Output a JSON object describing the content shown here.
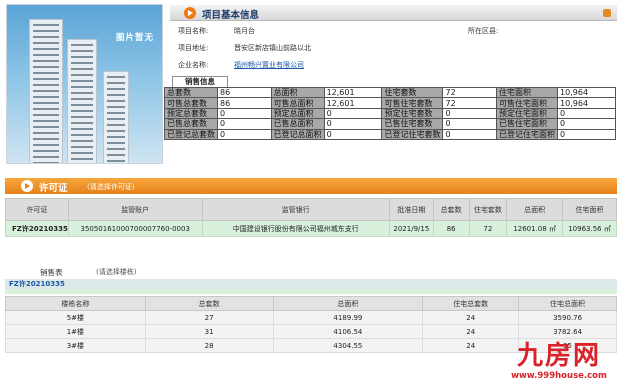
{
  "photo": {
    "no_photo_text": "图片暂无"
  },
  "project": {
    "title": "项目基本信息",
    "fields": [
      {
        "key": "项目名称:",
        "value": "晓月台"
      },
      {
        "key": "项目地址:",
        "value": "晋安区新店镇山前路以北"
      },
      {
        "key": "企业名称:",
        "value": "福州畅兴置业有限公司"
      }
    ],
    "district_label": "所在区县:"
  },
  "sales_info": {
    "tab": "销售信息",
    "rows": [
      [
        "总套数",
        "86",
        "总面积",
        "12,601",
        "住宅套数",
        "72",
        "住宅面积",
        "10,964"
      ],
      [
        "可售总套数",
        "86",
        "可售总面积",
        "12,601",
        "可售住宅套数",
        "72",
        "可售住宅面积",
        "10,964"
      ],
      [
        "预定总套数",
        "0",
        "预定总面积",
        "0",
        "预定住宅套数",
        "0",
        "预定住宅面积",
        "0"
      ],
      [
        "已售总套数",
        "0",
        "已售总面积",
        "0",
        "已售住宅套数",
        "0",
        "已售住宅面积",
        "0"
      ],
      [
        "已登记总套数",
        "0",
        "已登记总面积",
        "0",
        "已登记住宅套数",
        "0",
        "已登记住宅面积",
        "0"
      ]
    ]
  },
  "permit": {
    "title": "许可证",
    "hint": "(请选择许可证)",
    "headers": [
      "许可证",
      "监管账户",
      "监管银行",
      "批准日期",
      "总套数",
      "住宅套数",
      "总面积",
      "住宅面积"
    ],
    "rows": [
      [
        "FZ许20210335",
        "35050161000700007760-0003",
        "中国建设银行股份有限公司福州城东支行",
        "2021/9/15",
        "86",
        "72",
        "12601.08 ㎡",
        "10963.56 ㎡"
      ]
    ]
  },
  "sales_table": {
    "label": "销售表",
    "hint": "(请选择楼栋)",
    "selected_permit": "FZ许20210335",
    "headers": [
      "楼栋名称",
      "总套数",
      "总面积",
      "住宅总套数",
      "住宅总面积"
    ],
    "rows": [
      [
        "5#楼",
        "27",
        "4189.99",
        "24",
        "3590.76"
      ],
      [
        "1#楼",
        "31",
        "4106.54",
        "24",
        "3782.64"
      ],
      [
        "3#楼",
        "28",
        "4304.55",
        "24",
        "35"
      ]
    ]
  },
  "watermark": {
    "brand": "九房网",
    "url": "www.999house.com"
  }
}
